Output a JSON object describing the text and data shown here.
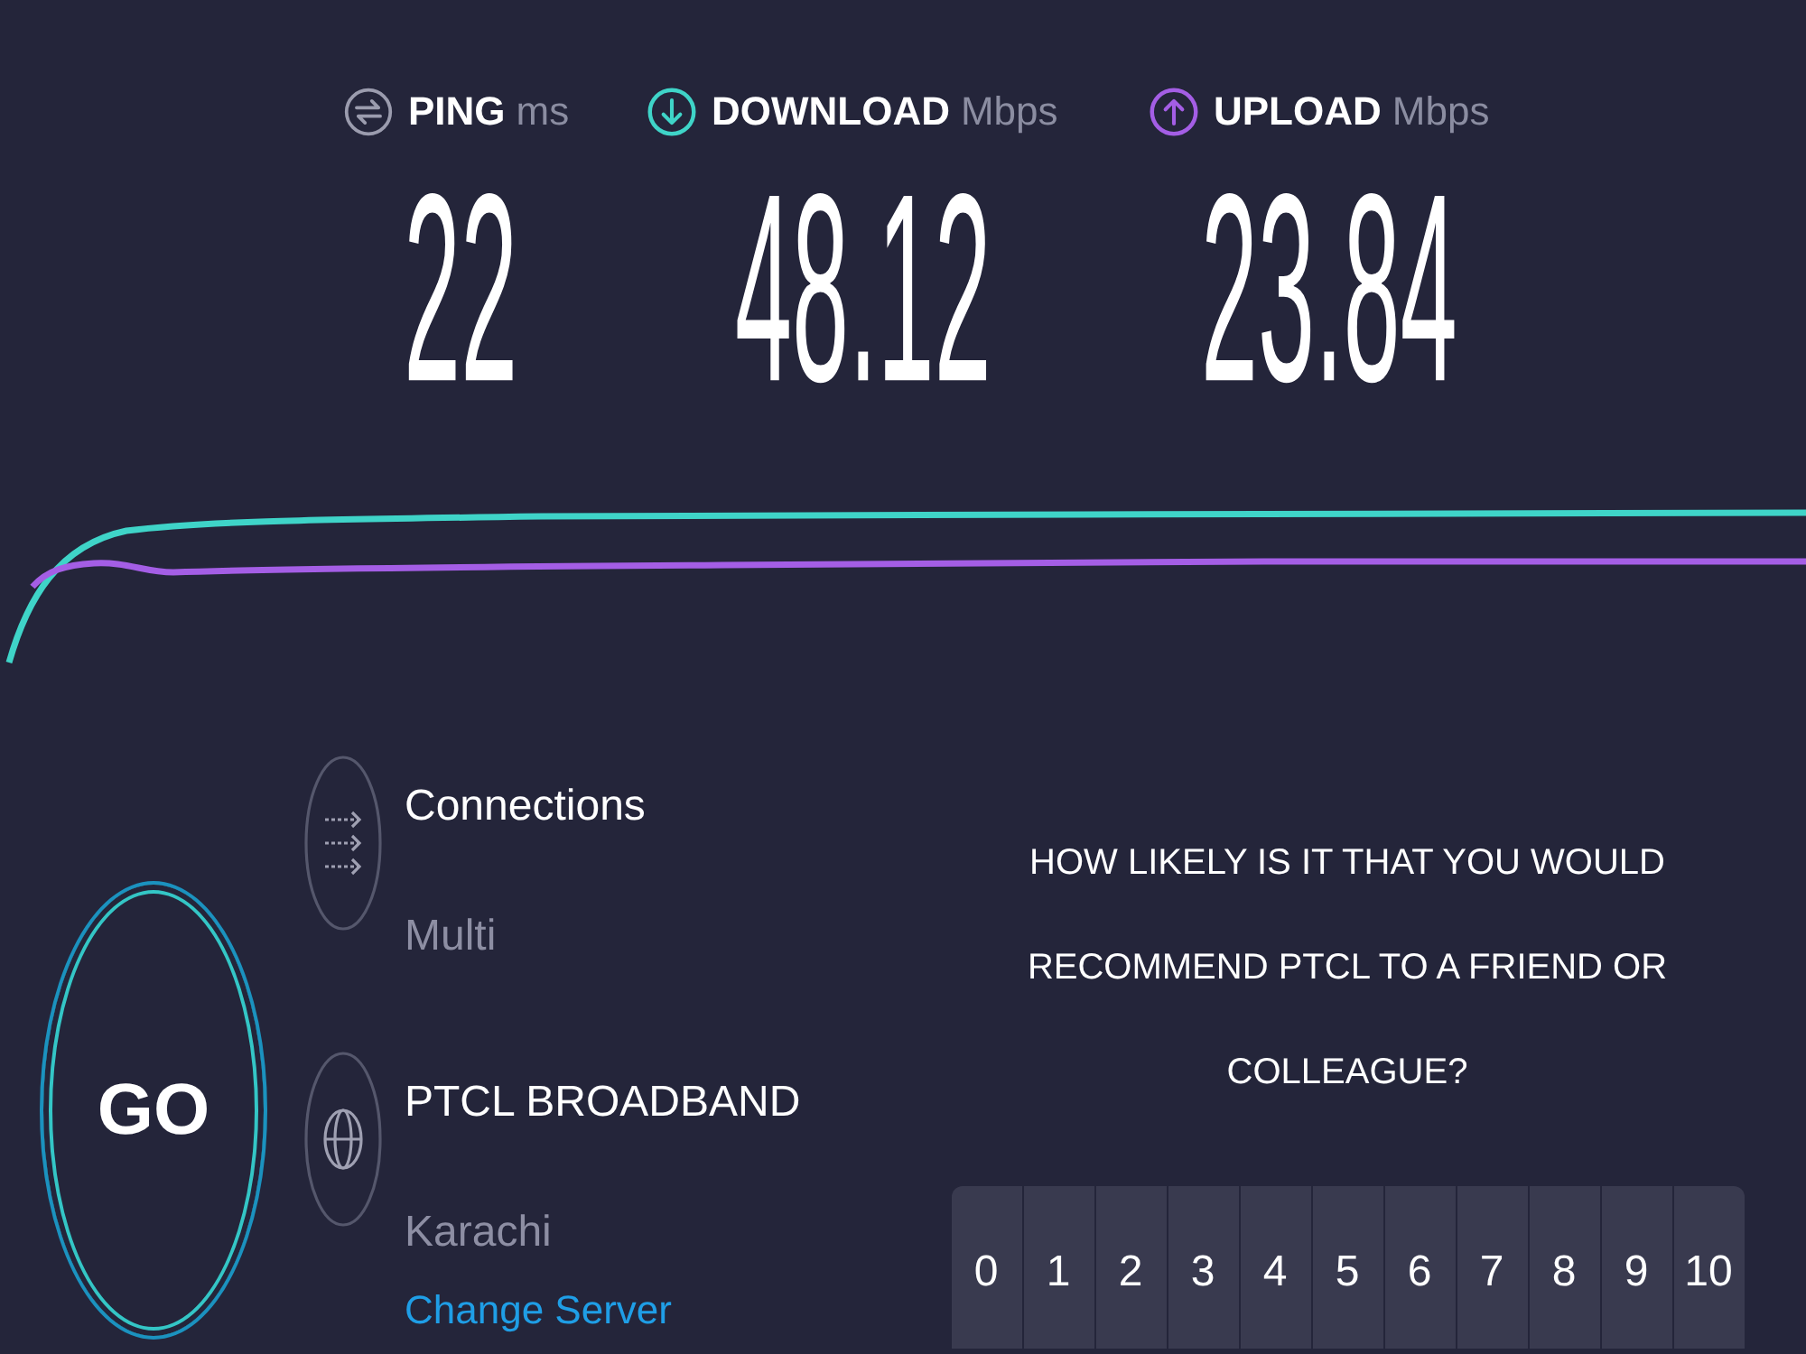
{
  "metrics": [
    {
      "kind": "ping",
      "label": "PING",
      "unit": "ms",
      "value": "22",
      "color": "#9b9cae"
    },
    {
      "kind": "download",
      "label": "DOWNLOAD",
      "unit": "Mbps",
      "value": "48.12",
      "color": "#3fd4c8"
    },
    {
      "kind": "upload",
      "label": "UPLOAD",
      "unit": "Mbps",
      "value": "23.84",
      "color": "#a45ee5"
    }
  ],
  "go_button": {
    "label": "GO"
  },
  "details": [
    {
      "kind": "connections",
      "title": "Connections",
      "value": "Multi"
    },
    {
      "kind": "server",
      "title": "PTCL BROADBAND",
      "value": "Karachi",
      "link": "Change Server"
    }
  ],
  "survey": {
    "question": "HOW LIKELY IS IT THAT YOU WOULD RECOMMEND PTCL TO A FRIEND OR COLLEAGUE?",
    "options": [
      {
        "label": "0",
        "selected": false
      },
      {
        "label": "1",
        "selected": false
      },
      {
        "label": "2",
        "selected": false
      },
      {
        "label": "3",
        "selected": false
      },
      {
        "label": "4",
        "selected": false
      },
      {
        "label": "5",
        "selected": false
      },
      {
        "label": "6",
        "selected": false
      },
      {
        "label": "7",
        "selected": false
      },
      {
        "label": "8",
        "selected": false
      },
      {
        "label": "9",
        "selected": false
      },
      {
        "label": "10",
        "selected": false
      }
    ]
  }
}
